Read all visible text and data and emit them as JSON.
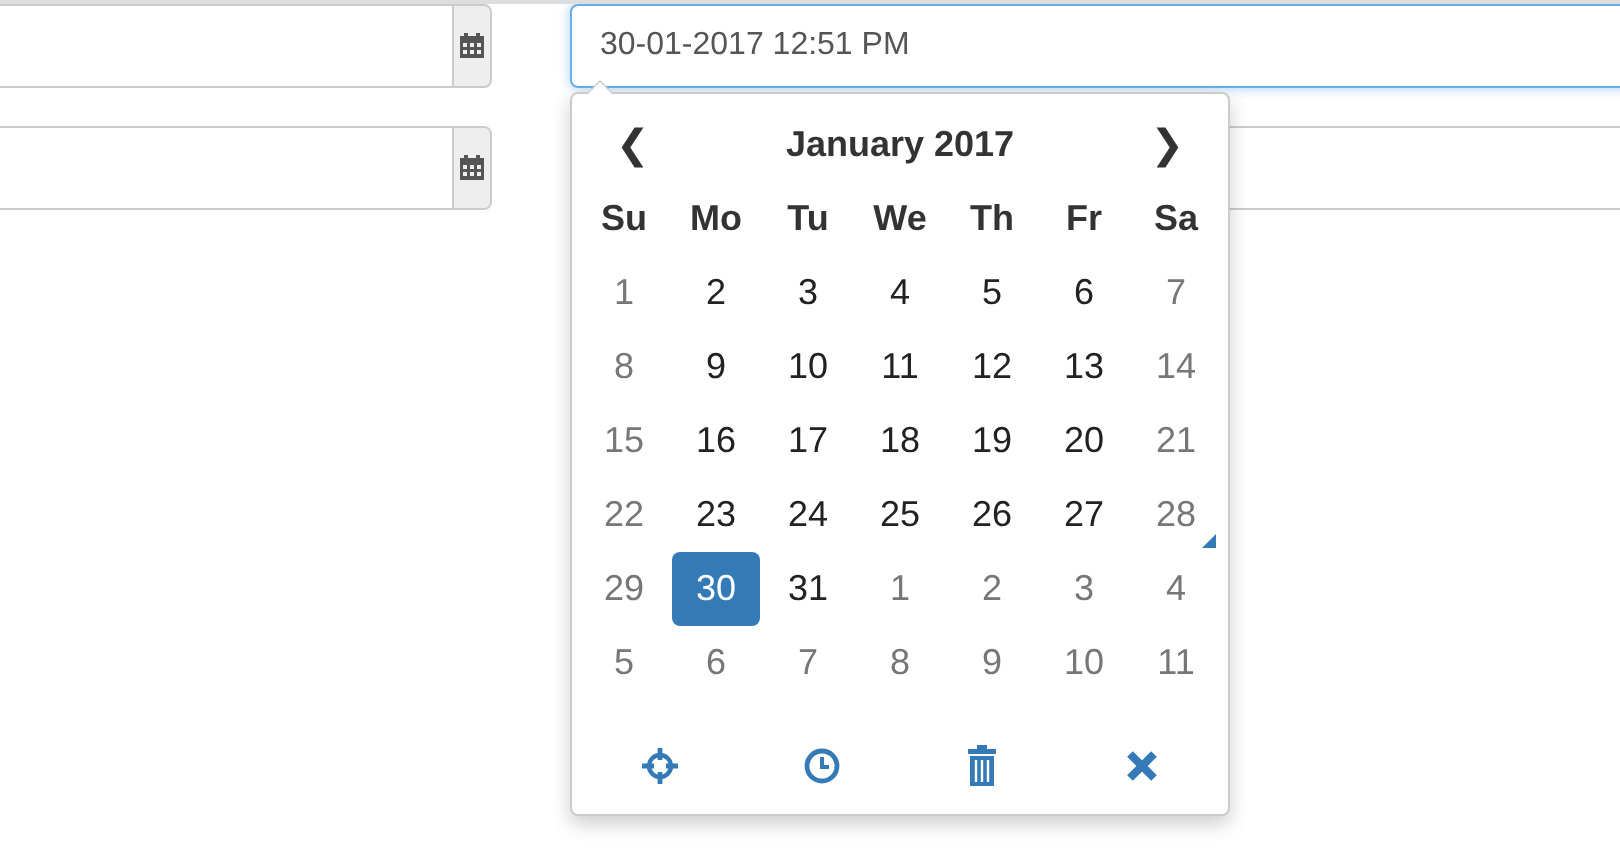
{
  "left_fields": [
    {
      "calendar_button": true
    },
    {
      "calendar_button": true
    }
  ],
  "right_fields": [
    {
      "value": "30-01-2017 12:51 PM",
      "focused": true
    },
    {
      "focused": false
    }
  ],
  "picker": {
    "month": "January 2017",
    "prev": "❮",
    "next": "❯",
    "weekdays": [
      "Su",
      "Mo",
      "Tu",
      "We",
      "Th",
      "Fr",
      "Sa"
    ],
    "weeks": [
      [
        {
          "label": "1",
          "muted": true,
          "selected": false,
          "today": false
        },
        {
          "label": "2",
          "muted": false,
          "selected": false,
          "today": false
        },
        {
          "label": "3",
          "muted": false,
          "selected": false,
          "today": false
        },
        {
          "label": "4",
          "muted": false,
          "selected": false,
          "today": false
        },
        {
          "label": "5",
          "muted": false,
          "selected": false,
          "today": false
        },
        {
          "label": "6",
          "muted": false,
          "selected": false,
          "today": false
        },
        {
          "label": "7",
          "muted": true,
          "selected": false,
          "today": false
        }
      ],
      [
        {
          "label": "8",
          "muted": true,
          "selected": false,
          "today": false
        },
        {
          "label": "9",
          "muted": false,
          "selected": false,
          "today": false
        },
        {
          "label": "10",
          "muted": false,
          "selected": false,
          "today": false
        },
        {
          "label": "11",
          "muted": false,
          "selected": false,
          "today": false
        },
        {
          "label": "12",
          "muted": false,
          "selected": false,
          "today": false
        },
        {
          "label": "13",
          "muted": false,
          "selected": false,
          "today": false
        },
        {
          "label": "14",
          "muted": true,
          "selected": false,
          "today": false
        }
      ],
      [
        {
          "label": "15",
          "muted": true,
          "selected": false,
          "today": false
        },
        {
          "label": "16",
          "muted": false,
          "selected": false,
          "today": false
        },
        {
          "label": "17",
          "muted": false,
          "selected": false,
          "today": false
        },
        {
          "label": "18",
          "muted": false,
          "selected": false,
          "today": false
        },
        {
          "label": "19",
          "muted": false,
          "selected": false,
          "today": false
        },
        {
          "label": "20",
          "muted": false,
          "selected": false,
          "today": false
        },
        {
          "label": "21",
          "muted": true,
          "selected": false,
          "today": false
        }
      ],
      [
        {
          "label": "22",
          "muted": true,
          "selected": false,
          "today": false
        },
        {
          "label": "23",
          "muted": false,
          "selected": false,
          "today": false
        },
        {
          "label": "24",
          "muted": false,
          "selected": false,
          "today": false
        },
        {
          "label": "25",
          "muted": false,
          "selected": false,
          "today": false
        },
        {
          "label": "26",
          "muted": false,
          "selected": false,
          "today": false
        },
        {
          "label": "27",
          "muted": false,
          "selected": false,
          "today": false
        },
        {
          "label": "28",
          "muted": true,
          "selected": false,
          "today": true
        }
      ],
      [
        {
          "label": "29",
          "muted": true,
          "selected": false,
          "today": false
        },
        {
          "label": "30",
          "muted": false,
          "selected": true,
          "today": false
        },
        {
          "label": "31",
          "muted": false,
          "selected": false,
          "today": false
        },
        {
          "label": "1",
          "muted": true,
          "selected": false,
          "today": false
        },
        {
          "label": "2",
          "muted": true,
          "selected": false,
          "today": false
        },
        {
          "label": "3",
          "muted": true,
          "selected": false,
          "today": false
        },
        {
          "label": "4",
          "muted": true,
          "selected": false,
          "today": false
        }
      ],
      [
        {
          "label": "5",
          "muted": true,
          "selected": false,
          "today": false
        },
        {
          "label": "6",
          "muted": true,
          "selected": false,
          "today": false
        },
        {
          "label": "7",
          "muted": true,
          "selected": false,
          "today": false
        },
        {
          "label": "8",
          "muted": true,
          "selected": false,
          "today": false
        },
        {
          "label": "9",
          "muted": true,
          "selected": false,
          "today": false
        },
        {
          "label": "10",
          "muted": true,
          "selected": false,
          "today": false
        },
        {
          "label": "11",
          "muted": true,
          "selected": false,
          "today": false
        }
      ]
    ],
    "tools": [
      {
        "kind": "today"
      },
      {
        "kind": "time"
      },
      {
        "kind": "clear"
      },
      {
        "kind": "close"
      }
    ]
  }
}
